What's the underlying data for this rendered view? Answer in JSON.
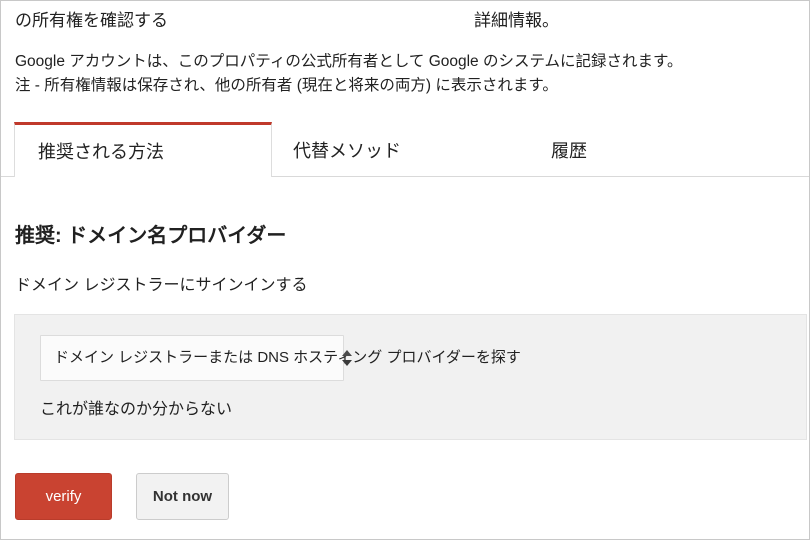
{
  "intro": {
    "title": "の所有権を確認する",
    "more_info": "詳細情報。",
    "paragraph_line1": "Google アカウントは、このプロパティの公式所有者として Google のシステムに記録されます。",
    "paragraph_line2": "注 - 所有権情報は保存され、他の所有者 (現在と将来の両方) に表示されます。"
  },
  "tabs": [
    {
      "label": "推奨される方法",
      "active": true
    },
    {
      "label": "代替メソッド",
      "active": false
    },
    {
      "label": "履歴",
      "active": false
    }
  ],
  "content": {
    "section_title": "推奨: ドメイン名プロバイダー",
    "section_subtitle": "ドメイン レジストラーにサインインする",
    "select": {
      "value": "ドメイン レジストラーまたは DNS ホスティング プロバイダーを探す",
      "icon": "updown-arrows-icon"
    },
    "note": "これが誰なのか分からない"
  },
  "actions": {
    "verify_label": "verify",
    "not_now_label": "Not now"
  },
  "colors": {
    "accent_red": "#c0392b",
    "button_red": "#c94331",
    "panel_gray": "#f1f1f1",
    "border_gray": "#d9d9d9"
  }
}
